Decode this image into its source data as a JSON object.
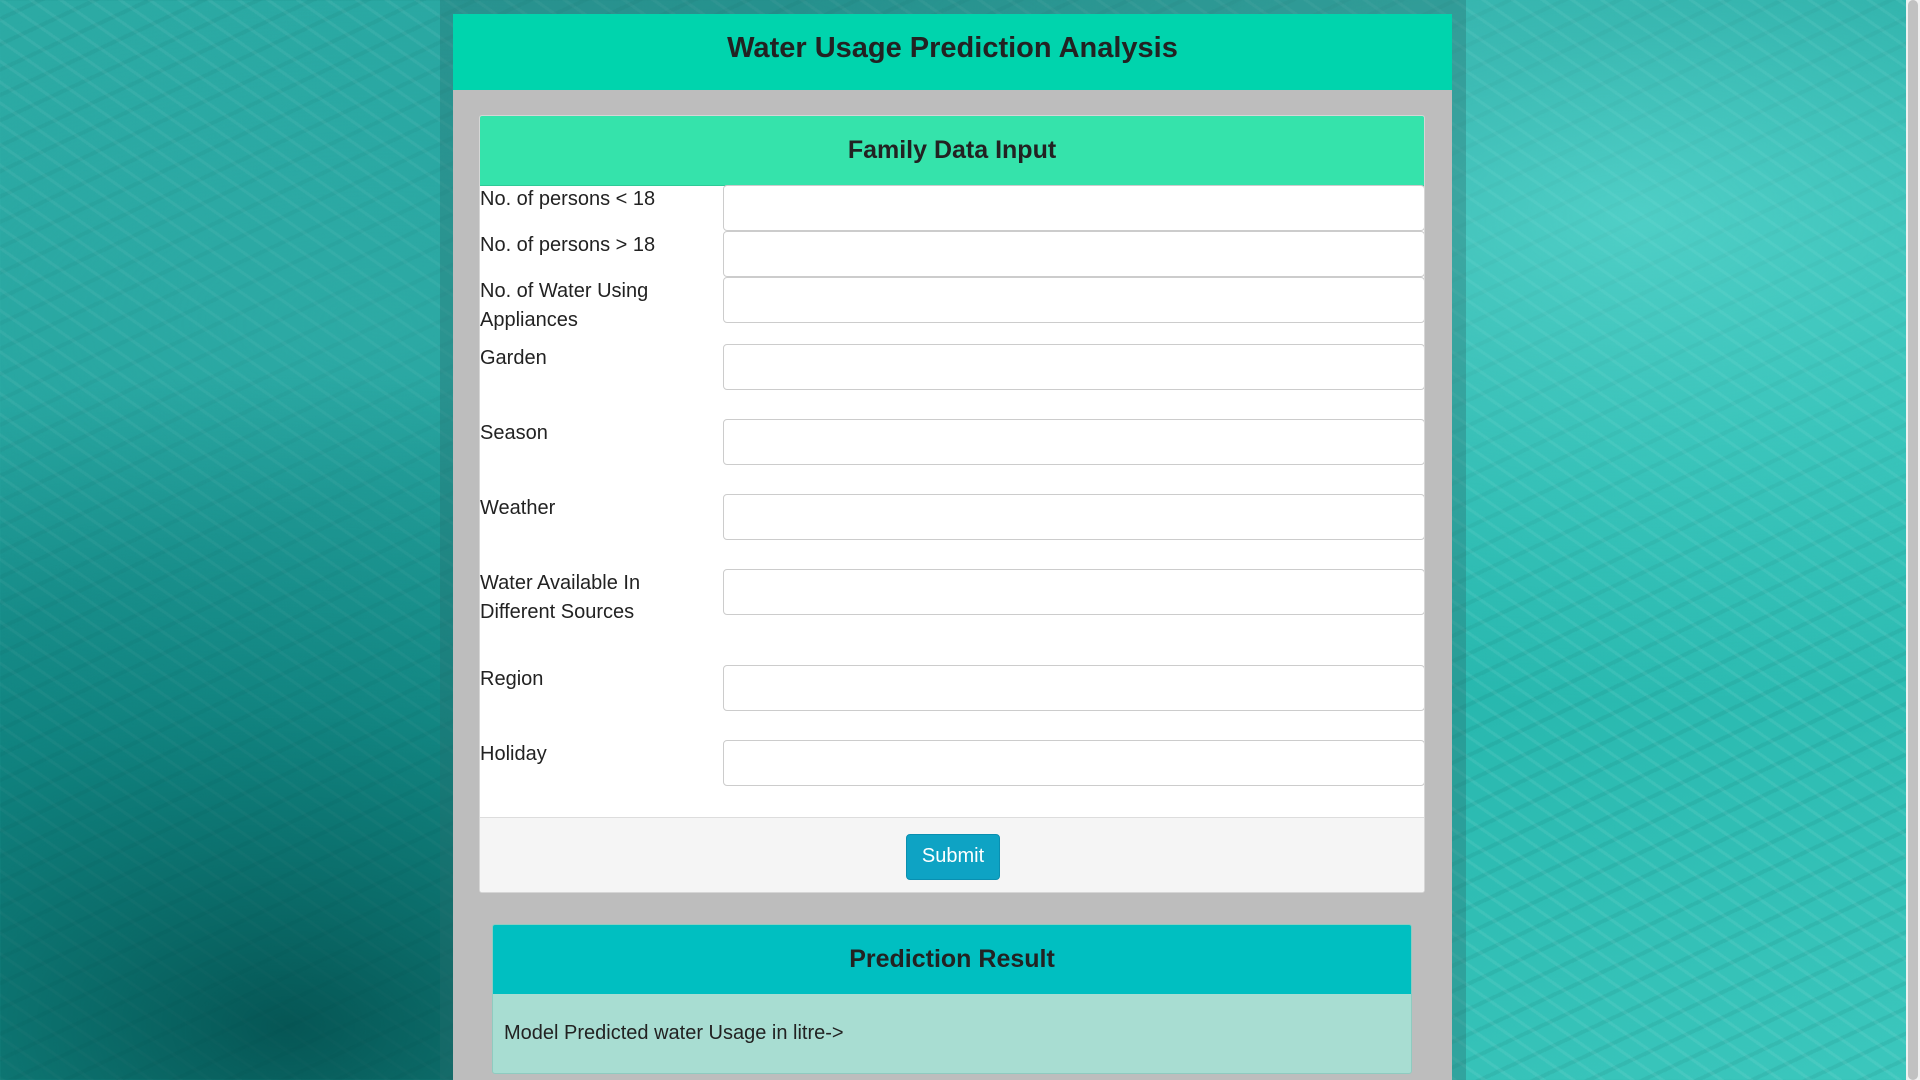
{
  "app": {
    "title": "Water Usage Prediction Analysis"
  },
  "form": {
    "title": "Family Data Input",
    "fields": [
      {
        "label": "No. of persons < 18",
        "value": "",
        "placeholder": ""
      },
      {
        "label": "No. of persons > 18",
        "value": "",
        "placeholder": ""
      },
      {
        "label": "No. of Water Using Appliances",
        "value": "",
        "placeholder": ""
      },
      {
        "label": "Garden",
        "value": "",
        "placeholder": ""
      },
      {
        "label": "Season",
        "value": "",
        "placeholder": ""
      },
      {
        "label": "Weather",
        "value": "",
        "placeholder": ""
      },
      {
        "label": "Water Available In Different Sources",
        "value": "",
        "placeholder": ""
      },
      {
        "label": "Region",
        "value": "",
        "placeholder": ""
      },
      {
        "label": "Holiday",
        "value": "",
        "placeholder": ""
      }
    ],
    "submit_label": "Submit"
  },
  "result": {
    "title": "Prediction Result",
    "text": "Model Predicted water Usage in litre->"
  },
  "colors": {
    "header_bg": "#00d4ad",
    "form_header_bg": "#35e3ab",
    "result_header_bg": "#00bfc1",
    "result_body_bg": "#a8ddd2",
    "submit_bg": "#0ea3c4"
  }
}
